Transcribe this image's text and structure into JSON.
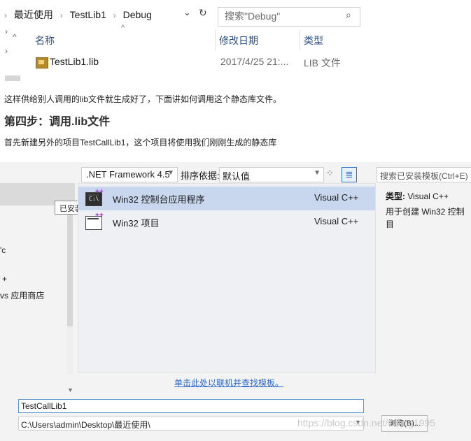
{
  "explorer": {
    "breadcrumb": [
      "最近使用",
      "TestLib1",
      "Debug"
    ],
    "search_placeholder": "搜索\"Debug\"",
    "columns": [
      "名称",
      "修改日期",
      "类型"
    ],
    "file": {
      "name": "TestLib1.lib",
      "date": "2017/4/25 21:...",
      "type": "LIB 文件"
    }
  },
  "article": {
    "p1": "这样供给别人调用的lib文件就生成好了，下面讲如何调用这个静态库文件。",
    "h": "第四步：调用.lib文件",
    "p2": "首先新建另外的项目TestCallLib1，这个项目将使用我们刚刚生成的静态库"
  },
  "dialog": {
    "framework": ".NET Framework 4.5",
    "sort_label": "排序依据:",
    "sort_value": "默认值",
    "search_placeholder": "搜索已安装模板(Ctrl+E)",
    "tooltip": "已安装",
    "left_items": [
      "'c",
      "+",
      "vs 应用商店"
    ],
    "templates": [
      {
        "name": "Win32 控制台应用程序",
        "lang": "Visual C++",
        "icon": "console-app-icon"
      },
      {
        "name": "Win32 项目",
        "lang": "Visual C++",
        "icon": "win32-project-icon"
      }
    ],
    "right_type_label": "类型:",
    "right_type_value": "Visual C++",
    "right_desc_1": "用于创建 Win32 控制",
    "right_desc_2": "目",
    "link_text": "单击此处以联机并查找模板。",
    "name_value": "TestCallLib1",
    "path_value": "C:\\Users\\admin\\Desktop\\最近使用\\",
    "browse_label": "浏览(B)...",
    "watermark": "https://blog.csdn.net/Cbing1995"
  }
}
